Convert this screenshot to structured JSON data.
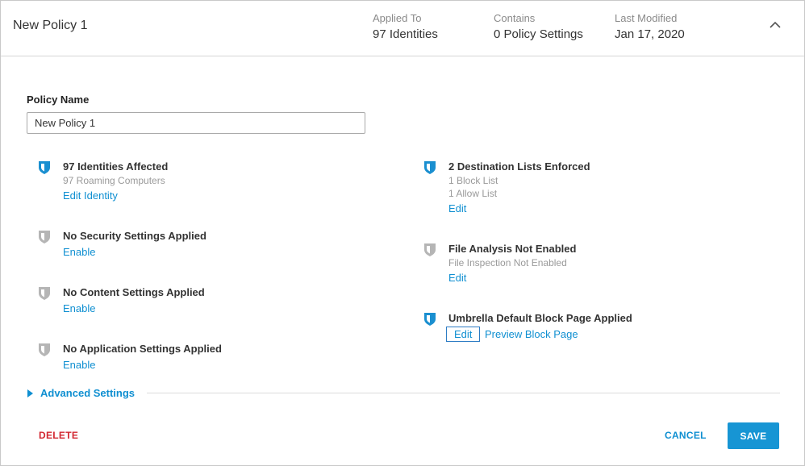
{
  "header": {
    "title": "New Policy 1",
    "applied_to_label": "Applied To",
    "applied_to_value": "97 Identities",
    "contains_label": "Contains",
    "contains_value": "0 Policy Settings",
    "last_modified_label": "Last Modified",
    "last_modified_value": "Jan 17, 2020"
  },
  "form": {
    "policy_name_label": "Policy Name",
    "policy_name_value": "New Policy 1"
  },
  "left_items": [
    {
      "title": "97 Identities Affected",
      "sub": [
        "97 Roaming Computers"
      ],
      "link": "Edit Identity",
      "active": true
    },
    {
      "title": "No Security Settings Applied",
      "sub": [],
      "link": "Enable",
      "active": false
    },
    {
      "title": "No Content Settings Applied",
      "sub": [],
      "link": "Enable",
      "active": false
    },
    {
      "title": "No Application Settings Applied",
      "sub": [],
      "link": "Enable",
      "active": false
    }
  ],
  "right_items": [
    {
      "title": "2 Destination Lists Enforced",
      "sub": [
        "1 Block List",
        "1 Allow List"
      ],
      "link": "Edit",
      "active": true
    },
    {
      "title": "File Analysis Not Enabled",
      "sub": [
        "File Inspection Not Enabled"
      ],
      "link": "Edit",
      "active": false
    },
    {
      "title": "Umbrella Default Block Page Applied",
      "sub": [],
      "link": "Edit",
      "link2": "Preview Block Page",
      "active": true
    }
  ],
  "advanced": {
    "label": "Advanced Settings"
  },
  "footer": {
    "delete_label": "DELETE",
    "cancel_label": "CANCEL",
    "save_label": "SAVE"
  },
  "colors": {
    "accent": "#0f8fd1",
    "shield_active": "#1a8fd0",
    "shield_inactive": "#b5b5b5",
    "danger": "#d22630"
  }
}
